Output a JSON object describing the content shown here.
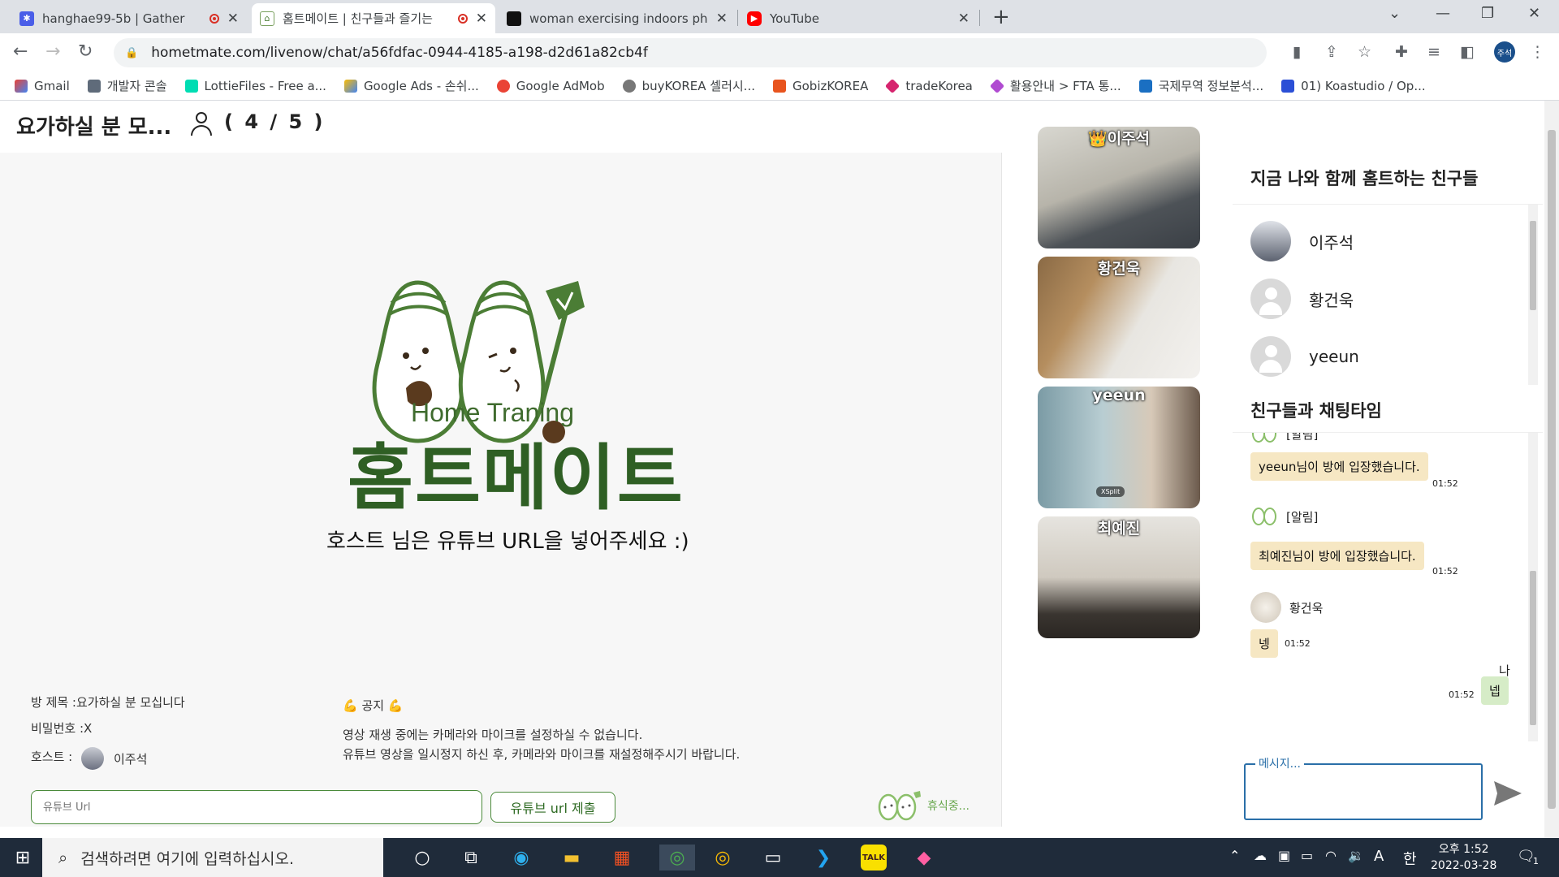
{
  "browser": {
    "tabs": [
      {
        "title": "hanghae99-5b | Gather",
        "recording": true
      },
      {
        "title": "홈트메이트 | 친구들과 즐기는",
        "recording": true
      },
      {
        "title": "woman exercising indoors phot"
      },
      {
        "title": "YouTube"
      }
    ],
    "url": "hometmate.com/livenow/chat/a56fdfac-0944-4185-a198-d2d61a82cb4f",
    "profile_label": "주석",
    "bookmarks": [
      "Gmail",
      "개발자 콘솔",
      "LottieFiles - Free a...",
      "Google Ads - 손쉬...",
      "Google AdMob",
      "buyKOREA 셀러시...",
      "GobizKOREA",
      "tradeKorea",
      "활용안내 > FTA 통...",
      "국제무역 정보분석...",
      "01) Koastudio / Op..."
    ]
  },
  "room": {
    "title": "요가하실 분 모...",
    "count": "( 4 / 5 )"
  },
  "main": {
    "logo_sub": "Home Traning",
    "logo_main": "홈트메이트",
    "host_message": "호스트 님은 유튜브 URL을 넣어주세요 :)",
    "room_name": "방 제목 :요가하실 분 모십니다",
    "password": "비밀번호 :X",
    "host_label": "호스트 :",
    "host_name": "이주석",
    "notice_title": "💪 공지 💪",
    "notice_line1": "영상 재생 중에는 카메라와 마이크를 설정하실 수 없습니다.",
    "notice_line2": "유튜브 영상을 일시정지 하신 후, 카메라와 마이크를 재설정해주시기 바랍니다.",
    "url_placeholder": "유튜브 Url",
    "url_button": "유튜브 url 제출",
    "rest_status": "휴식중..."
  },
  "videos": [
    {
      "name": "👑이주석"
    },
    {
      "name": "황건욱"
    },
    {
      "name": "yeeun"
    },
    {
      "name": "최예진"
    }
  ],
  "panel": {
    "friends_title": "지금 나와 함께 홈트하는 친구들",
    "friends": [
      "이주석",
      "황건욱",
      "yeeun"
    ],
    "chat_title": "친구들과 채팅타임",
    "chat": {
      "partial_sender": "[알림]",
      "msg1": "yeeun님이 방에 입장했습니다.",
      "msg1_time": "01:52",
      "notice_sender": "[알림]",
      "msg2": "최예진님이 방에 입장했습니다.",
      "msg2_time": "01:52",
      "user_sender": "황건욱",
      "msg3": "넹",
      "msg3_time": "01:52",
      "me_label": "나",
      "my_msg": "넵",
      "my_msg_time": "01:52"
    },
    "message_placeholder": "메시지..."
  },
  "taskbar": {
    "search_placeholder": "검색하려면 여기에 입력하십시오.",
    "ime": "한",
    "lang": "A",
    "time": "오후 1:52",
    "date": "2022-03-28",
    "notification_count": "1"
  },
  "colors": {
    "brand_green": "#2f5f24",
    "chat_bubble": "#f6e7c3",
    "my_bubble": "#d6ecc7",
    "input_focus": "#2a6fa8"
  }
}
